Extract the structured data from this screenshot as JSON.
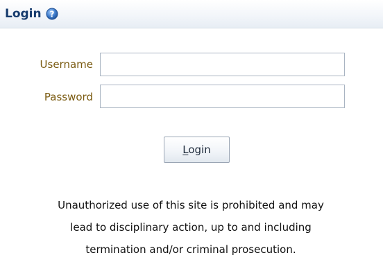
{
  "header": {
    "title": "Login",
    "help_icon": "help-question-icon"
  },
  "form": {
    "username_label": "Username",
    "username_value": "",
    "password_label": "Password",
    "password_value": "",
    "login_button_label": "Login"
  },
  "notice": {
    "lines": [
      "Unauthorized use of this site is prohibited and may",
      "lead to disciplinary action, up to and including",
      "termination and/or criminal prosecution."
    ]
  },
  "colors": {
    "title": "#163b6d",
    "field_label": "#7a5a10",
    "help_icon": "#3a78c8"
  }
}
